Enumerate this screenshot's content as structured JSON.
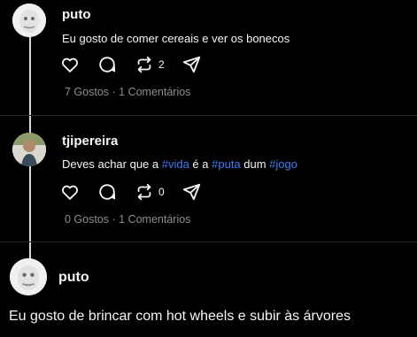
{
  "posts": [
    {
      "username": "puto",
      "text": "Eu gosto de comer cereais e ver os bonecos",
      "repost_count": "2",
      "likes_text": "7 Gostos",
      "separator": " · ",
      "comments_text": "1 Comentários"
    },
    {
      "username": "tjipereira",
      "text_parts": [
        "Deves achar que a ",
        "#vida",
        " é a ",
        "#puta",
        " dum ",
        "#jogo"
      ],
      "repost_count": "0",
      "likes_text": "0 Gostos",
      "separator": " · ",
      "comments_text": "1 Comentários"
    }
  ],
  "reply": {
    "username": "puto",
    "text": "Eu gosto de brincar com hot wheels e subir às árvores"
  },
  "colors": {
    "background": "#000000",
    "hashtag": "#3d7cf0",
    "muted": "#8e8e8e",
    "thread_line": "#d9d9d9"
  },
  "icons": [
    "heart-icon",
    "comment-icon",
    "repost-icon",
    "share-icon"
  ]
}
